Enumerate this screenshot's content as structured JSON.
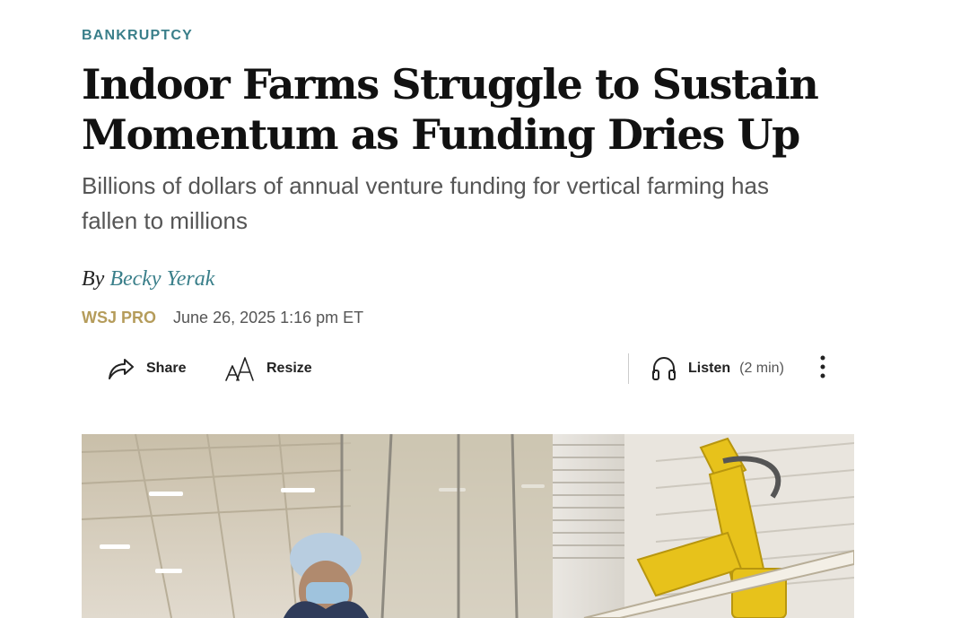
{
  "article": {
    "section": "BANKRUPTCY",
    "headline_line1": "Indoor Farms Struggle to Sustain",
    "headline_line2": "Momentum as Funding Dries Up",
    "dek_line1": "Billions of dollars of annual venture funding for vertical farming has",
    "dek_line2": "fallen to millions",
    "byline_prefix": "By",
    "author": "Becky Yerak",
    "source": "WSJ PRO",
    "date": "June 26, 2025 1:16 pm ET"
  },
  "toolbar": {
    "share_label": "Share",
    "resize_label": "Resize",
    "listen_label": "Listen",
    "listen_duration": "(2 min)"
  },
  "icons": {
    "share": "share-arrow-icon",
    "resize": "text-resize-icon",
    "listen": "headphones-icon",
    "more": "more-vertical-icon"
  },
  "colors": {
    "accent": "#3a7f8a",
    "source": "#b59c5b",
    "text": "#111111",
    "muted": "#555555"
  }
}
